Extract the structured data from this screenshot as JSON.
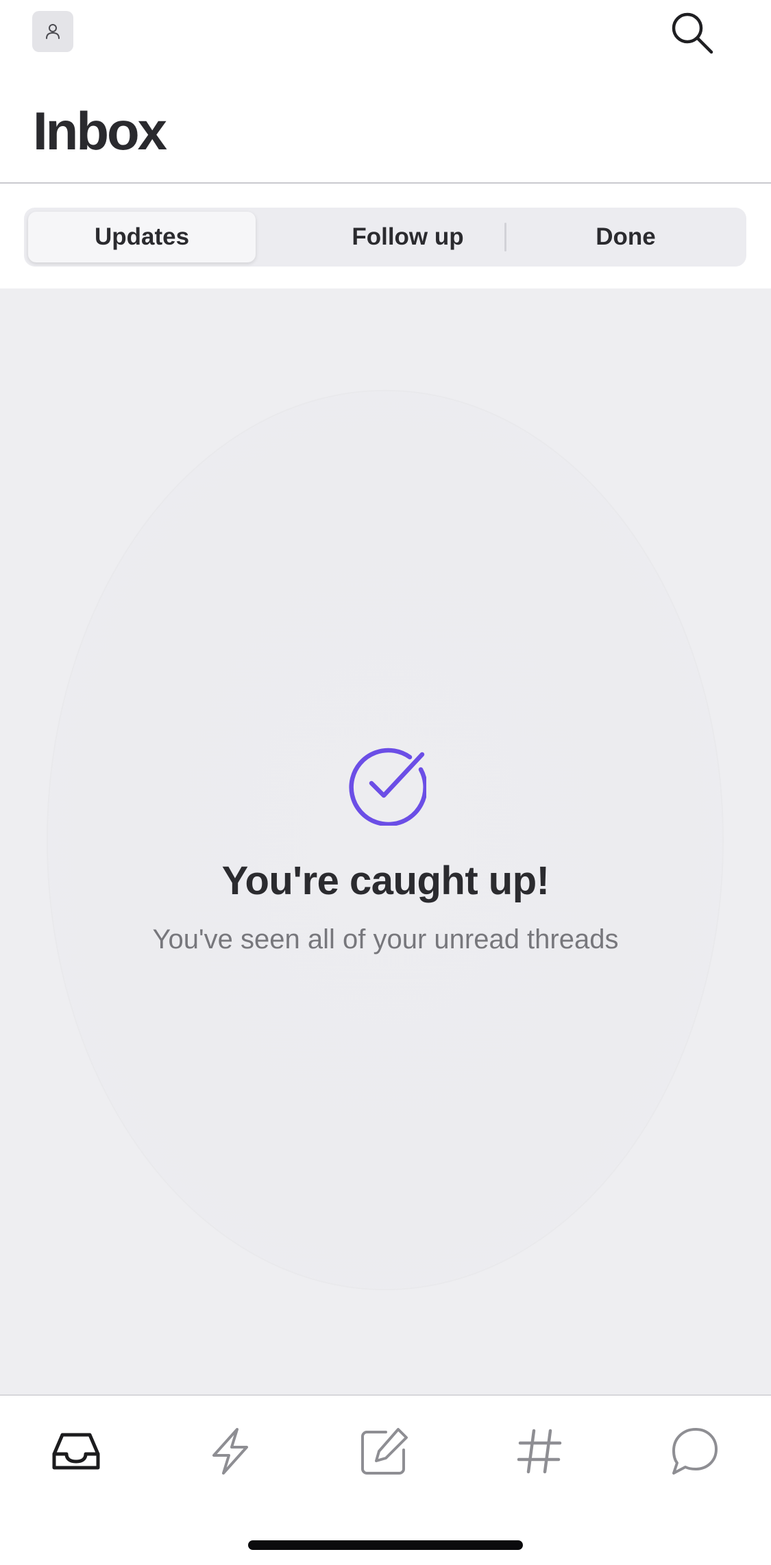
{
  "header": {
    "title": "Inbox",
    "avatar_icon": "person-icon",
    "search_icon": "search-icon"
  },
  "segments": {
    "updates": "Updates",
    "follow_up": "Follow up",
    "done": "Done",
    "selected": "Updates"
  },
  "empty_state": {
    "icon": "check-circle-icon",
    "title": "You're caught up!",
    "subtitle": "You've seen all of your unread threads"
  },
  "tabbar": {
    "items": [
      {
        "name": "inbox",
        "icon": "inbox-tray-icon",
        "active": true
      },
      {
        "name": "activity",
        "icon": "lightning-bolt-icon",
        "active": false
      },
      {
        "name": "compose",
        "icon": "compose-icon",
        "active": false
      },
      {
        "name": "channels",
        "icon": "hash-icon",
        "active": false
      },
      {
        "name": "direct-messages",
        "icon": "chat-bubble-icon",
        "active": false
      }
    ]
  },
  "colors": {
    "accent": "#6b4ee6",
    "background": "#eeeef1",
    "text_primary": "#2b2b2f",
    "text_secondary": "#77777c",
    "tab_active": "#1c1c1e",
    "tab_inactive": "#8e8e93"
  }
}
